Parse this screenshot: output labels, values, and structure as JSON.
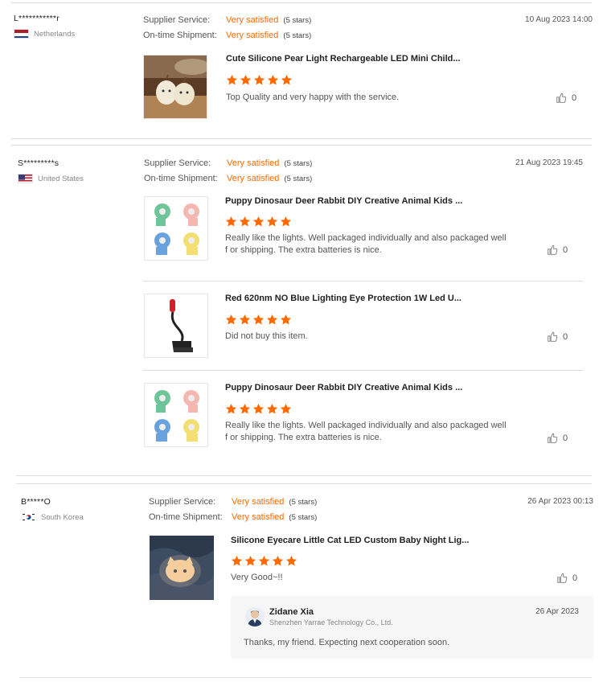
{
  "labels": {
    "supplier_service": "Supplier Service:",
    "ontime_shipment": "On-time Shipment:"
  },
  "colors": {
    "accent": "#ff6a00",
    "star": "#ff6a00"
  },
  "reviews": [
    {
      "reviewer": "L***********r",
      "country": "Netherlands",
      "flag_icon": "netherlands-flag-icon",
      "supplier_service": "Very satisfied",
      "supplier_service_stars": "(5 stars)",
      "shipment": "Very satisfied",
      "shipment_stars": "(5 stars)",
      "date": "10 Aug 2023 14:00",
      "items": [
        {
          "title": "Cute Silicone Pear Light Rechargeable LED Mini Child...",
          "rating": 5,
          "text": "Top Quality and very happy with the service.",
          "likes": "0"
        }
      ]
    },
    {
      "reviewer": "S*********s",
      "country": "United States",
      "flag_icon": "us-flag-icon",
      "supplier_service": "Very satisfied",
      "supplier_service_stars": "(5 stars)",
      "shipment": "Very satisfied",
      "shipment_stars": "(5 stars)",
      "date": "21 Aug 2023 19:45",
      "items": [
        {
          "title": "Puppy Dinosaur Deer Rabbit DIY Creative Animal Kids ...",
          "rating": 5,
          "text": "Really like the lights. Well packaged individually and also packaged well f or shipping. The extra batteries is nice.",
          "likes": "0"
        },
        {
          "title": "Red 620nm NO Blue Lighting Eye Protection 1W Led U...",
          "rating": 5,
          "text": "Did not buy this item.",
          "likes": "0"
        },
        {
          "title": "Puppy Dinosaur Deer Rabbit DIY Creative Animal Kids ...",
          "rating": 5,
          "text": "Really like the lights. Well packaged individually and also packaged well f or shipping. The extra batteries is nice.",
          "likes": "0"
        }
      ]
    },
    {
      "reviewer": "B*****O",
      "country": "South Korea",
      "flag_icon": "south-korea-flag-icon",
      "supplier_service": "Very satisfied",
      "supplier_service_stars": "(5 stars)",
      "shipment": "Very satisfied",
      "shipment_stars": "(5 stars)",
      "date": "26 Apr 2023 00:13",
      "items": [
        {
          "title": "Silicone Eyecare Little Cat LED Custom Baby Night Lig...",
          "rating": 5,
          "text": "Very Good~!!",
          "likes": "0"
        }
      ],
      "reply": {
        "name": "Zidane Xia",
        "company": "Shenzhen Yarrae Technology Co., Ltd.",
        "date": "26 Apr 2023",
        "message": "Thanks, my friend. Expecting next cooperation soon."
      }
    }
  ]
}
